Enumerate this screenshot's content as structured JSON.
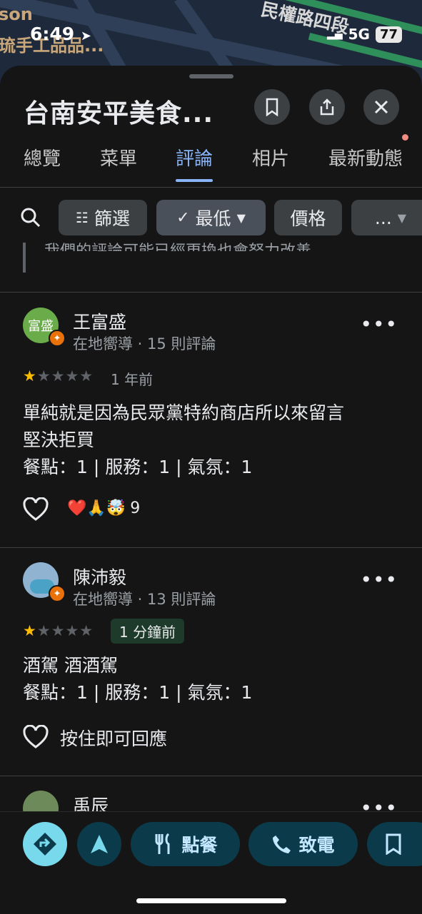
{
  "map": {
    "poi_1": "son",
    "poi_2": "琉手工品品...",
    "street": "民權路四段"
  },
  "status_bar": {
    "time": "6:49",
    "network": "5G",
    "battery": "77"
  },
  "header": {
    "title": "台南安平美食..."
  },
  "tabs": [
    "總覽",
    "菜單",
    "評論",
    "相片",
    "最新動態"
  ],
  "active_tab": "評論",
  "filters": {
    "filter_label": "篩選",
    "sort_label": "最低",
    "price_label": "價格",
    "more_label": "..."
  },
  "previous_snippet": "我們的評論可能已經更換也會努力改善",
  "reviews": [
    {
      "avatar_text": "富盛",
      "avatar_color": "#6aab4a",
      "name": "王富盛",
      "meta": "在地嚮導 · 15 則評論",
      "rating": 1,
      "time": "1 年前",
      "lines": [
        "單純就是因為民眾黨特約商店所以來留言",
        "堅決拒買",
        "餐點：1 | 服務：1 | 氣氛：1"
      ],
      "reactions": "❤️🙏🤯",
      "reaction_count": "9"
    },
    {
      "avatar_text": "",
      "avatar_color": "#8fb3d1",
      "name": "陳沛毅",
      "meta": "在地嚮導 · 13 則評論",
      "rating": 1,
      "time": "1 分鐘前",
      "lines": [
        "酒駕 酒酒駕",
        "餐點：1 | 服務：1 | 氣氛：1"
      ],
      "reply_hint": "按住即可回應"
    },
    {
      "name": "禹辰"
    }
  ],
  "bottom_bar": {
    "order_label": "點餐",
    "call_label": "致電"
  },
  "colors": {
    "accent": "#8ab4f8",
    "star": "#fbbc04",
    "button_bg": "#0b3b4a"
  }
}
